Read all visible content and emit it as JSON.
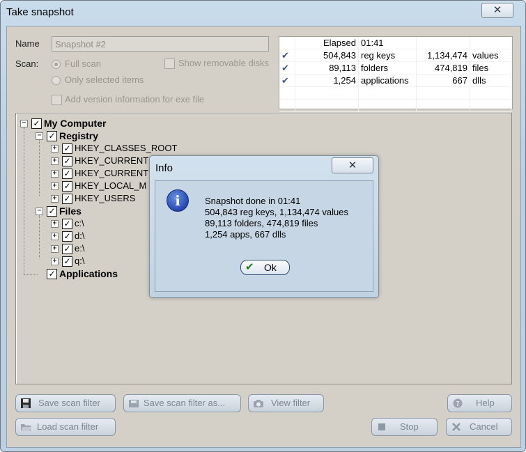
{
  "window": {
    "title": "Take snapshot",
    "close_glyph": "✕"
  },
  "form": {
    "name_label": "Name",
    "name_value": "Snapshot #2",
    "scan_label": "Scan:",
    "full_scan_label": "Full scan",
    "only_selected_label": "Only selected items",
    "show_removable_label": "Show removable disks",
    "add_version_label": "Add version information for exe file"
  },
  "stats": {
    "elapsed_label": "Elapsed",
    "elapsed_value": "01:41",
    "rows": [
      {
        "count1": "504,843",
        "label1": "reg keys",
        "count2": "1,134,474",
        "label2": "values"
      },
      {
        "count1": "89,113",
        "label1": "folders",
        "count2": "474,819",
        "label2": "files"
      },
      {
        "count1": "1,254",
        "label1": "applications",
        "count2": "667",
        "label2": "dlls"
      }
    ],
    "tick_glyph": "✔"
  },
  "tree": {
    "expanded_glyph": "−",
    "collapsed_glyph": "+",
    "check_glyph": "✓",
    "my_computer": "My Computer",
    "registry": "Registry",
    "registry_items": [
      "HKEY_CLASSES_ROOT",
      "HKEY_CURRENT",
      "HKEY_CURRENT",
      "HKEY_LOCAL_M",
      "HKEY_USERS"
    ],
    "files": "Files",
    "file_items": [
      "c:\\",
      "d:\\",
      "e:\\",
      "q:\\"
    ],
    "applications": "Applications"
  },
  "buttons": {
    "save_scan_filter": "Save scan filter",
    "save_scan_filter_as": "Save scan filter as...",
    "view_filter": "View filter",
    "help": "Help",
    "load_scan_filter": "Load scan filter",
    "stop": "Stop",
    "cancel": "Cancel"
  },
  "info_dialog": {
    "title": "Info",
    "close_glyph": "✕",
    "icon_glyph": "i",
    "lines": [
      "Snapshot done in 01:41",
      "504,843 reg keys, 1,134,474 values",
      "89,113 folders, 474,819 files",
      "1,254 apps, 667 dlls"
    ],
    "ok_label": "Ok",
    "ok_glyph": "✔"
  }
}
